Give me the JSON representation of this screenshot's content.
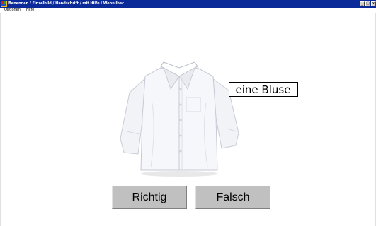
{
  "window": {
    "title": "Benennen / Einzelbild / Handschrift / mit Hilfe / Wehnilbec",
    "controls": [
      "_",
      "□",
      "×"
    ]
  },
  "menubar": {
    "items": [
      "Optionen",
      "Hilfe"
    ]
  },
  "main": {
    "image_icon": "shirt-image",
    "word": "eine Bluse",
    "buttons": {
      "correct": "Richtig",
      "wrong": "Falsch"
    }
  },
  "colors": {
    "titlebar": "#0a2a9a",
    "button_face": "#c0c0c0",
    "background": "#ffffff"
  }
}
